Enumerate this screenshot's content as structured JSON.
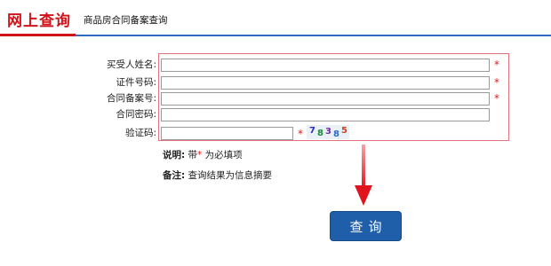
{
  "header": {
    "title": "网上查询",
    "subtitle": "商品房合同备案查询"
  },
  "form": {
    "fields": [
      {
        "label": "买受人姓名:",
        "value": "",
        "required": true
      },
      {
        "label": "证件号码:",
        "value": "",
        "required": true
      },
      {
        "label": "合同备案号:",
        "value": "",
        "required": true
      },
      {
        "label": "合同密码:",
        "value": "",
        "required": false
      },
      {
        "label": "验证码:",
        "value": "",
        "required": true
      }
    ],
    "required_mark": "*",
    "captcha": {
      "text": "78385",
      "digits": [
        "7",
        "8",
        "3",
        "8",
        "5"
      ],
      "colors": [
        "#2b2bd0",
        "#1a8a3a",
        "#6a2aa0",
        "#2b6bd0",
        "#d0401a"
      ]
    }
  },
  "notes": {
    "explain_key": "说明:",
    "explain_prefix": "带",
    "explain_star": "*",
    "explain_suffix": " 为必填项",
    "remark_key": "备注:",
    "remark_text": "查询结果为信息摘要"
  },
  "submit": {
    "label": "查询"
  },
  "colors": {
    "brand_red": "#d0121b",
    "button_blue": "#1f5ea8",
    "header_blue_line": "#2f6bbf"
  }
}
